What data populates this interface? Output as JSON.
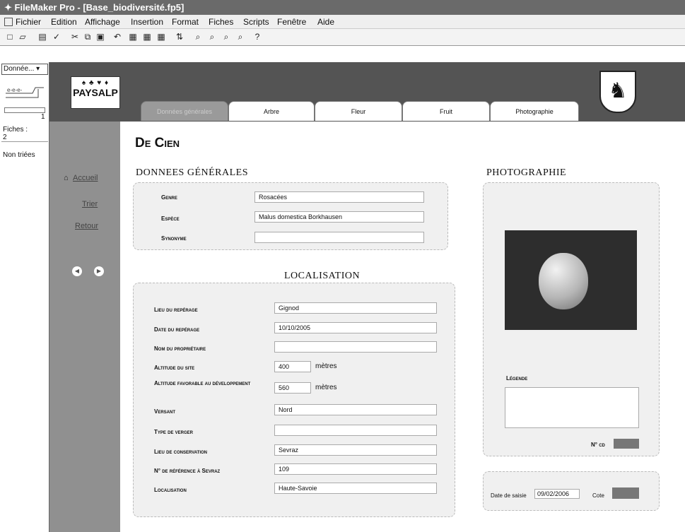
{
  "window": {
    "title": "FileMaker Pro - [Base_biodiversité.fp5]"
  },
  "menu": [
    "Fichier",
    "Edition",
    "Affichage",
    "Insertion",
    "Format",
    "Fiches",
    "Scripts",
    "Fenêtre",
    "Aide"
  ],
  "status": {
    "layout": "Donnée...",
    "record_number": "1",
    "records_label": "Fiches :",
    "records_count": "2",
    "sort_state": "Non triées"
  },
  "header": {
    "logo_text": "PAYSALP"
  },
  "tabs": [
    "Données générales",
    "Arbre",
    "Fleur",
    "Fruit",
    "Photographie"
  ],
  "nav": {
    "home": "Accueil",
    "sort": "Trier",
    "back": "Retour"
  },
  "record": {
    "title": "De Cien"
  },
  "general": {
    "title": "DONNEES GÉNÉRALES",
    "genre_label": "Genre",
    "genre": "Rosacées",
    "espece_label": "Espèce",
    "espece": "Malus domestica Borkhausen",
    "synonyme_label": "Synonyme",
    "synonyme": ""
  },
  "localisation": {
    "title": "LOCALISATION",
    "lieu_label": "Lieu du repérage",
    "lieu": "Gignod",
    "date_label": "Date du repérage",
    "date": "10/10/2005",
    "proprio_label": "Nom du propriétaire",
    "proprio": "",
    "altitude_label": "Altitude du site",
    "altitude": "400",
    "altitude_unit": "mètres",
    "altfav_label": "Altitude favorable au développement",
    "altfav": "560",
    "altfav_unit": "mètres",
    "versant_label": "Versant",
    "versant": "Nord",
    "verger_label": "Type de verger",
    "verger": "",
    "conservation_label": "Lieu de conservation",
    "conservation": "Sevraz",
    "ref_label": "N° de référence à Sevraz",
    "ref": "109",
    "localisation_label": "Localisation",
    "localisation": "Haute-Savoie"
  },
  "photo": {
    "title": "PHOTOGRAPHIE",
    "legend_label": "Légende",
    "legend": "",
    "num_label": "N° cd",
    "num": ""
  },
  "saisie": {
    "date_label": "Date de saisie",
    "date": "09/02/2006",
    "cote_label": "Cote",
    "cote": ""
  },
  "colors": {
    "header_bg": "#545454",
    "nav_bg": "#909090",
    "tab_active": "#9a9a9a"
  }
}
